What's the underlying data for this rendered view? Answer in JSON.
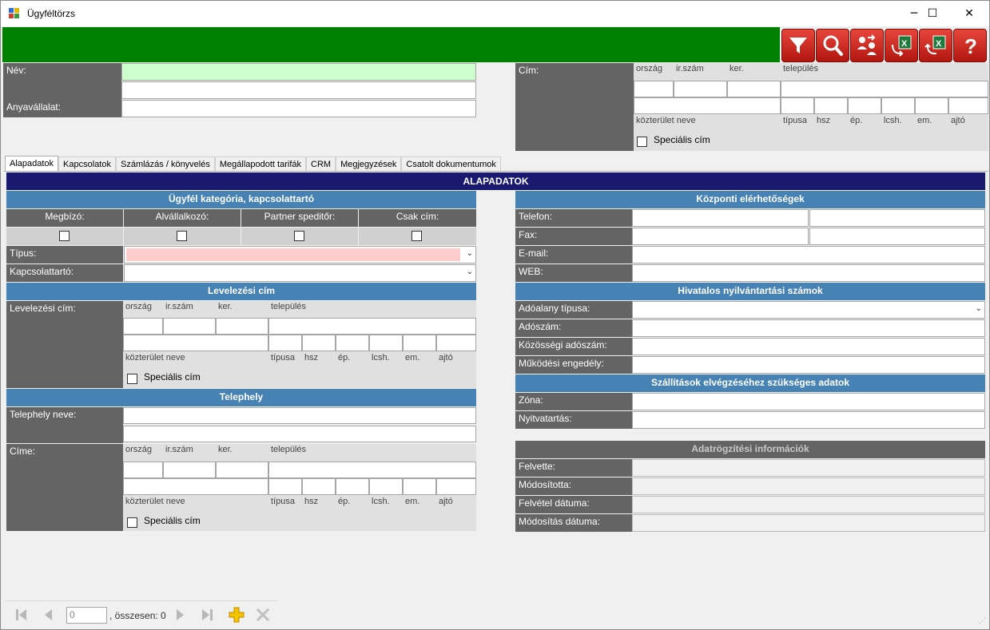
{
  "window": {
    "title": "Ügyféltörzs",
    "minimize": "─",
    "maximize": "☐",
    "close": "✕"
  },
  "toolbar": {
    "buttons": [
      "filter-icon",
      "search-icon",
      "users-transfer-icon",
      "excel-import-icon",
      "excel-export-icon",
      "help-icon"
    ]
  },
  "header": {
    "name_label": "Név:",
    "parent_label": "Anyavállalat:",
    "address_label": "Cím:",
    "addr_sub_top": [
      "ország",
      "ir.szám",
      "ker.",
      "település"
    ],
    "addr_sub_bottom": [
      "közterület neve",
      "típusa",
      "hsz",
      "ép.",
      "lcsh.",
      "em.",
      "ajtó"
    ],
    "special_address": "Speciális cím"
  },
  "tabs": [
    "Alapadatok",
    "Kapcsolatok",
    "Számlázás / könyvelés",
    "Megállapodott tarifák",
    "CRM",
    "Megjegyzések",
    "Csatolt dokumentumok"
  ],
  "panel_title": "ALAPADATOK",
  "left": {
    "category_header": "Ügyfél kategória, kapcsolattartó",
    "categories": [
      "Megbízó:",
      "Alvállalkozó:",
      "Partner speditőr:",
      "Csak cím:"
    ],
    "type_label": "Típus:",
    "contact_label": "Kapcsolattartó:",
    "mail_header": "Levelezési cím",
    "mail_label": "Levelezési cím:",
    "site_header": "Telephely",
    "site_name_label": "Telephely neve:",
    "site_addr_label": "Címe:"
  },
  "right": {
    "central_header": "Központi elérhetőségek",
    "phone_label": "Telefon:",
    "fax_label": "Fax:",
    "email_label": "E-mail:",
    "web_label": "WEB:",
    "official_header": "Hivatalos nyilvántartási számok",
    "taxpayer_type_label": "Adóalany típusa:",
    "tax_number_label": "Adószám:",
    "eu_tax_label": "Közösségi adószám:",
    "license_label": "Működési engedély:",
    "shipping_header": "Szállítások elvégzéséhez szükséges adatok",
    "zone_label": "Zóna:",
    "hours_label": "Nyitvatartás:",
    "audit_header": "Adatrögzítési információk",
    "created_by_label": "Felvette:",
    "modified_by_label": "Módosította:",
    "created_date_label": "Felvétel dátuma:",
    "modified_date_label": "Módosítás dátuma:"
  },
  "navigator": {
    "position_value": "0",
    "total_text": ", összesen: 0"
  },
  "colors": {
    "green_bar": "#008000",
    "dark_label": "#646464",
    "section_header": "#4682b4",
    "panel_title": "#191970",
    "name_input": "#ccffcc",
    "type_input": "#ffcccc"
  }
}
